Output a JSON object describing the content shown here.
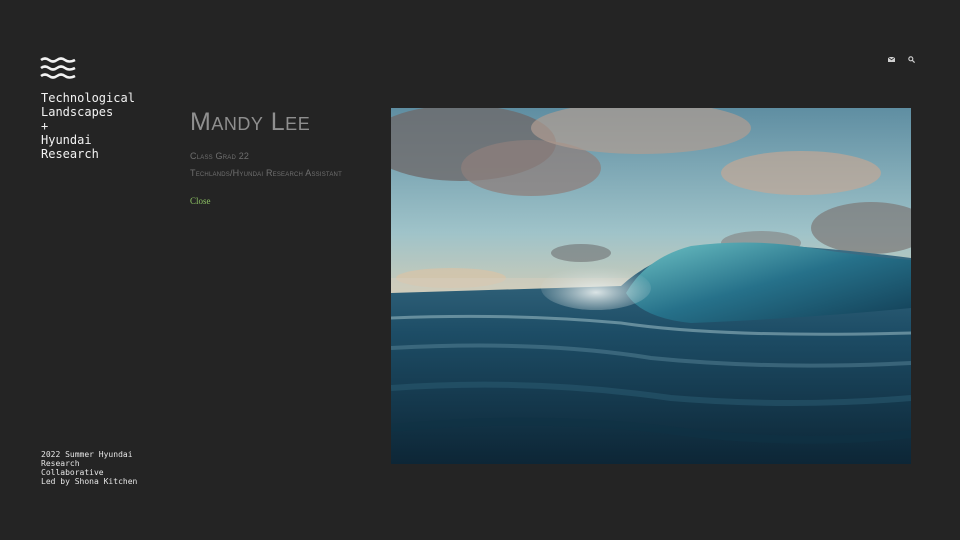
{
  "site": {
    "title_lines": [
      "Technological",
      "Landscapes",
      "+",
      "Hyundai",
      "Research"
    ],
    "logo_icon": "waves-icon",
    "footer_lines": [
      "2022 Summer Hyundai",
      "Research",
      "Collaborative",
      "Led by Shona Kitchen"
    ]
  },
  "header": {
    "icons": [
      "mail-icon",
      "search-icon"
    ]
  },
  "profile": {
    "name": "Mandy Lee",
    "role_lines": [
      "Class Grad 22",
      "Techlands/Hyundai Research Assistant"
    ],
    "close_label": "Close",
    "photo_subject": "ocean-wave-photo"
  },
  "colors": {
    "background": "#242424",
    "title_text": "#f2f2f2",
    "name_text": "#8f8f8f",
    "role_text": "#6f6f6f",
    "link": "#8cc063"
  }
}
